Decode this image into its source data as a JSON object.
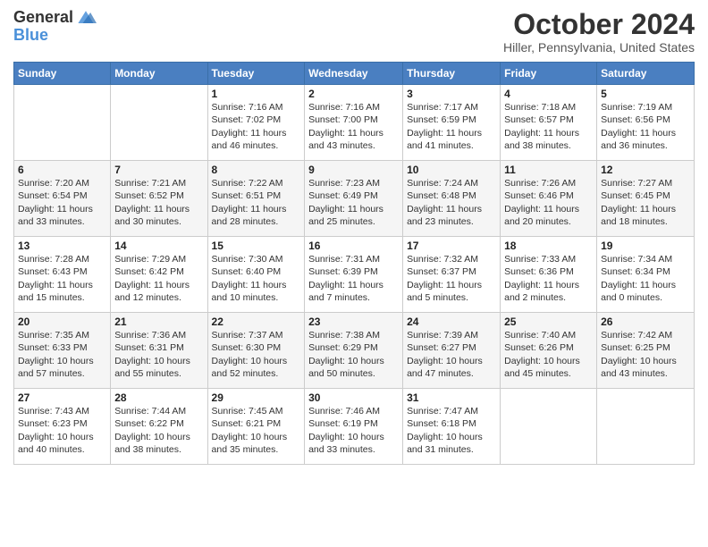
{
  "header": {
    "logo_general": "General",
    "logo_blue": "Blue",
    "month": "October 2024",
    "location": "Hiller, Pennsylvania, United States"
  },
  "weekdays": [
    "Sunday",
    "Monday",
    "Tuesday",
    "Wednesday",
    "Thursday",
    "Friday",
    "Saturday"
  ],
  "weeks": [
    [
      {
        "day": "",
        "info": ""
      },
      {
        "day": "",
        "info": ""
      },
      {
        "day": "1",
        "info": "Sunrise: 7:16 AM\nSunset: 7:02 PM\nDaylight: 11 hours and 46 minutes."
      },
      {
        "day": "2",
        "info": "Sunrise: 7:16 AM\nSunset: 7:00 PM\nDaylight: 11 hours and 43 minutes."
      },
      {
        "day": "3",
        "info": "Sunrise: 7:17 AM\nSunset: 6:59 PM\nDaylight: 11 hours and 41 minutes."
      },
      {
        "day": "4",
        "info": "Sunrise: 7:18 AM\nSunset: 6:57 PM\nDaylight: 11 hours and 38 minutes."
      },
      {
        "day": "5",
        "info": "Sunrise: 7:19 AM\nSunset: 6:56 PM\nDaylight: 11 hours and 36 minutes."
      }
    ],
    [
      {
        "day": "6",
        "info": "Sunrise: 7:20 AM\nSunset: 6:54 PM\nDaylight: 11 hours and 33 minutes."
      },
      {
        "day": "7",
        "info": "Sunrise: 7:21 AM\nSunset: 6:52 PM\nDaylight: 11 hours and 30 minutes."
      },
      {
        "day": "8",
        "info": "Sunrise: 7:22 AM\nSunset: 6:51 PM\nDaylight: 11 hours and 28 minutes."
      },
      {
        "day": "9",
        "info": "Sunrise: 7:23 AM\nSunset: 6:49 PM\nDaylight: 11 hours and 25 minutes."
      },
      {
        "day": "10",
        "info": "Sunrise: 7:24 AM\nSunset: 6:48 PM\nDaylight: 11 hours and 23 minutes."
      },
      {
        "day": "11",
        "info": "Sunrise: 7:26 AM\nSunset: 6:46 PM\nDaylight: 11 hours and 20 minutes."
      },
      {
        "day": "12",
        "info": "Sunrise: 7:27 AM\nSunset: 6:45 PM\nDaylight: 11 hours and 18 minutes."
      }
    ],
    [
      {
        "day": "13",
        "info": "Sunrise: 7:28 AM\nSunset: 6:43 PM\nDaylight: 11 hours and 15 minutes."
      },
      {
        "day": "14",
        "info": "Sunrise: 7:29 AM\nSunset: 6:42 PM\nDaylight: 11 hours and 12 minutes."
      },
      {
        "day": "15",
        "info": "Sunrise: 7:30 AM\nSunset: 6:40 PM\nDaylight: 11 hours and 10 minutes."
      },
      {
        "day": "16",
        "info": "Sunrise: 7:31 AM\nSunset: 6:39 PM\nDaylight: 11 hours and 7 minutes."
      },
      {
        "day": "17",
        "info": "Sunrise: 7:32 AM\nSunset: 6:37 PM\nDaylight: 11 hours and 5 minutes."
      },
      {
        "day": "18",
        "info": "Sunrise: 7:33 AM\nSunset: 6:36 PM\nDaylight: 11 hours and 2 minutes."
      },
      {
        "day": "19",
        "info": "Sunrise: 7:34 AM\nSunset: 6:34 PM\nDaylight: 11 hours and 0 minutes."
      }
    ],
    [
      {
        "day": "20",
        "info": "Sunrise: 7:35 AM\nSunset: 6:33 PM\nDaylight: 10 hours and 57 minutes."
      },
      {
        "day": "21",
        "info": "Sunrise: 7:36 AM\nSunset: 6:31 PM\nDaylight: 10 hours and 55 minutes."
      },
      {
        "day": "22",
        "info": "Sunrise: 7:37 AM\nSunset: 6:30 PM\nDaylight: 10 hours and 52 minutes."
      },
      {
        "day": "23",
        "info": "Sunrise: 7:38 AM\nSunset: 6:29 PM\nDaylight: 10 hours and 50 minutes."
      },
      {
        "day": "24",
        "info": "Sunrise: 7:39 AM\nSunset: 6:27 PM\nDaylight: 10 hours and 47 minutes."
      },
      {
        "day": "25",
        "info": "Sunrise: 7:40 AM\nSunset: 6:26 PM\nDaylight: 10 hours and 45 minutes."
      },
      {
        "day": "26",
        "info": "Sunrise: 7:42 AM\nSunset: 6:25 PM\nDaylight: 10 hours and 43 minutes."
      }
    ],
    [
      {
        "day": "27",
        "info": "Sunrise: 7:43 AM\nSunset: 6:23 PM\nDaylight: 10 hours and 40 minutes."
      },
      {
        "day": "28",
        "info": "Sunrise: 7:44 AM\nSunset: 6:22 PM\nDaylight: 10 hours and 38 minutes."
      },
      {
        "day": "29",
        "info": "Sunrise: 7:45 AM\nSunset: 6:21 PM\nDaylight: 10 hours and 35 minutes."
      },
      {
        "day": "30",
        "info": "Sunrise: 7:46 AM\nSunset: 6:19 PM\nDaylight: 10 hours and 33 minutes."
      },
      {
        "day": "31",
        "info": "Sunrise: 7:47 AM\nSunset: 6:18 PM\nDaylight: 10 hours and 31 minutes."
      },
      {
        "day": "",
        "info": ""
      },
      {
        "day": "",
        "info": ""
      }
    ]
  ]
}
